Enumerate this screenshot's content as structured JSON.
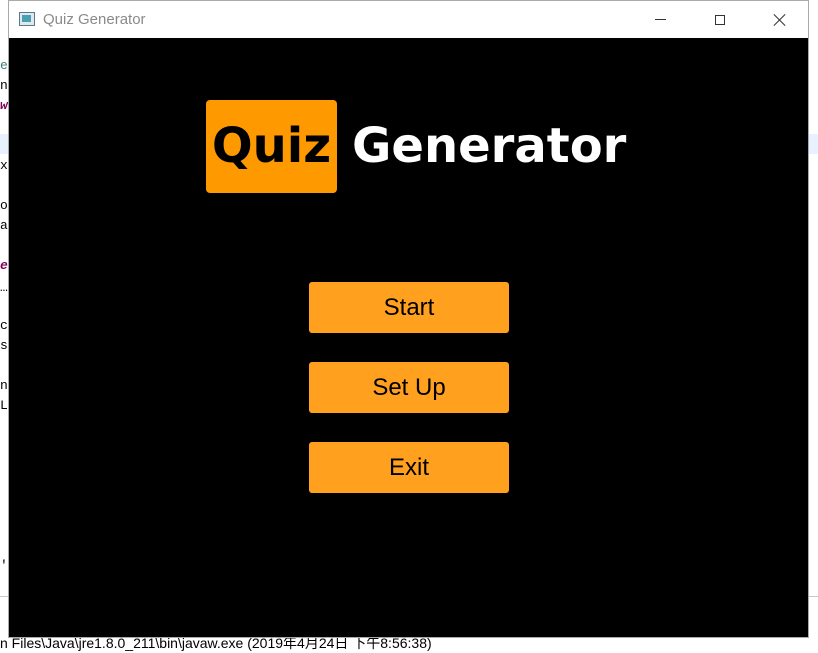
{
  "background_ide": {
    "fragments": [
      {
        "text": "e",
        "style": "tl"
      },
      {
        "text": "na",
        "style": "plain"
      },
      {
        "text": "w",
        "style": "kw"
      },
      {
        "text": "x(",
        "style": "plain"
      },
      {
        "text": "os",
        "style": "plain"
      },
      {
        "text": "ac",
        "style": "plain"
      },
      {
        "text": "ew",
        "style": "kw"
      },
      {
        "text": " …",
        "style": "plain"
      },
      {
        "text": "ce",
        "style": "plain"
      },
      {
        "text": "s (",
        "style": "plain"
      },
      {
        "text": "ne",
        "style": "plain"
      },
      {
        "text": "Le",
        "style": "plain"
      },
      {
        "text": "'S",
        "style": "plain"
      }
    ],
    "console_line": "n Files\\Java\\jre1.8.0_211\\bin\\javaw.exe (2019年4月24日 下午8:56:38)"
  },
  "window": {
    "title": "Quiz Generator",
    "icon": "java-app-icon",
    "controls": {
      "minimize": "minimize-icon",
      "maximize": "maximize-icon",
      "close": "close-icon"
    }
  },
  "logo": {
    "boxed_word": "Quiz",
    "word": "Generator",
    "accent_color": "#ff9900"
  },
  "menu": {
    "start_label": "Start",
    "setup_label": "Set Up",
    "exit_label": "Exit",
    "button_color": "#ffa11f"
  }
}
